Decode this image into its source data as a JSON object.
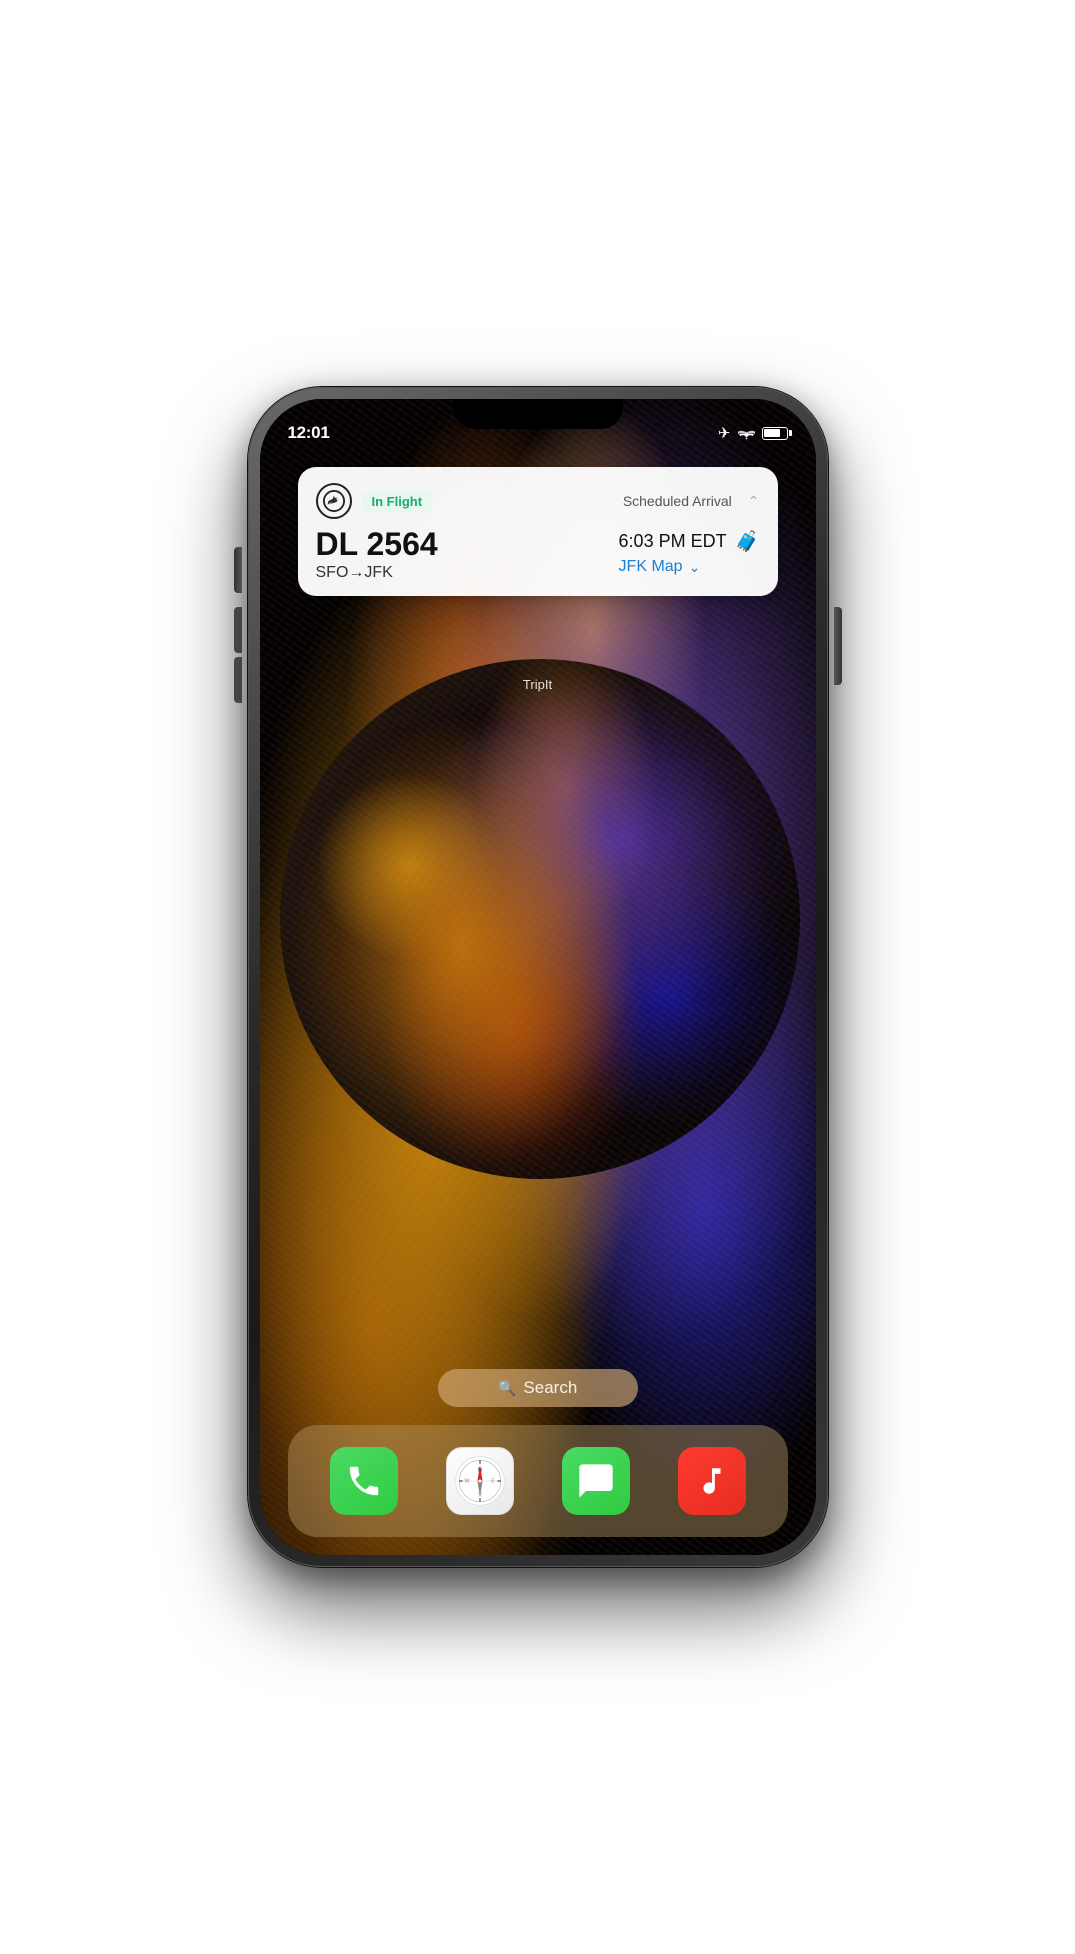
{
  "phone": {
    "status_bar": {
      "time": "12:01"
    },
    "notification": {
      "app_icon_label": "flight-icon",
      "in_flight_badge": "In Flight",
      "scheduled_label": "Scheduled Arrival",
      "flight_number": "DL 2564",
      "route": "SFO→JFK",
      "arrival_time": "6:03 PM EDT",
      "map_link": "JFK Map",
      "chevron_up": "︿",
      "chevron_down": "﹀"
    },
    "tripit_label": "TripIt",
    "search_bar": {
      "label": "Search",
      "icon": "🔍"
    },
    "dock": {
      "apps": [
        {
          "name": "Phone",
          "type": "phone"
        },
        {
          "name": "Safari",
          "type": "safari"
        },
        {
          "name": "Messages",
          "type": "messages"
        },
        {
          "name": "Music",
          "type": "music"
        }
      ]
    }
  }
}
